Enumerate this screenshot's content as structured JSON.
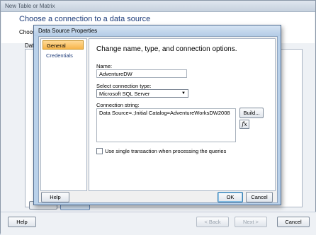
{
  "outer": {
    "title": "New Table or Matrix",
    "heading": "Choose a connection to a data source",
    "choose_label": "Choose",
    "data_label": "Data",
    "buttons": {
      "help": "Help",
      "back": "< Back",
      "next": "Next >",
      "cancel": "Cancel"
    }
  },
  "dialog": {
    "title": "Data Source Properties",
    "nav": [
      {
        "label": "General",
        "active": true
      },
      {
        "label": "Credentials",
        "active": false
      }
    ],
    "content_title": "Change name, type, and connection options.",
    "name_label": "Name:",
    "name_value": "AdventureDW",
    "type_label": "Select connection type:",
    "type_value": "Microsoft SQL Server",
    "conn_label": "Connection string:",
    "conn_value": "Data Source=.;Initial Catalog=AdventureWorksDW2008",
    "build_label": "Build...",
    "fx_label": "fx",
    "checkbox_label": "Use single transaction when processing the queries",
    "buttons": {
      "help": "Help",
      "ok": "OK",
      "cancel": "Cancel"
    }
  },
  "colors": {
    "accent": "#f7b54b",
    "heading": "#1f3d7a"
  }
}
